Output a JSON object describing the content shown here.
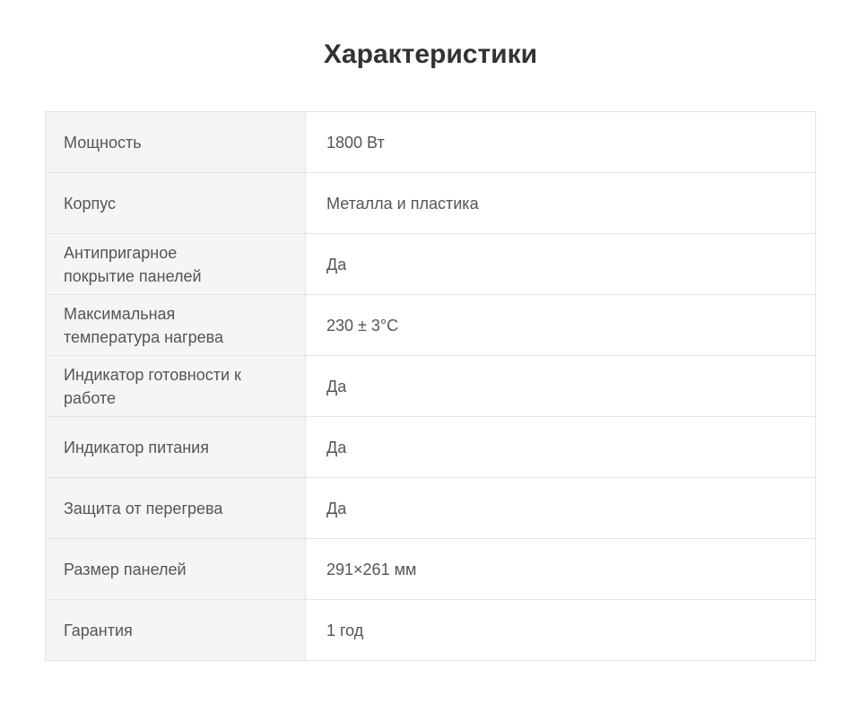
{
  "page": {
    "title": "Характеристики"
  },
  "specs": [
    {
      "label": "Мощность",
      "value": "1800 Вт"
    },
    {
      "label": "Корпус",
      "value": "Металла и пластика"
    },
    {
      "label": "Антипригарное покрытие панелей",
      "value": "Да"
    },
    {
      "label": "Максимальная температура нагрева",
      "value": "230 ± 3°С"
    },
    {
      "label": "Индикатор готовности к работе",
      "value": "Да"
    },
    {
      "label": "Индикатор питания",
      "value": "Да"
    },
    {
      "label": "Защита от перегрева",
      "value": "Да"
    },
    {
      "label": "Размер панелей",
      "value": "291×261 мм"
    },
    {
      "label": "Гарантия",
      "value": "1 год"
    }
  ]
}
